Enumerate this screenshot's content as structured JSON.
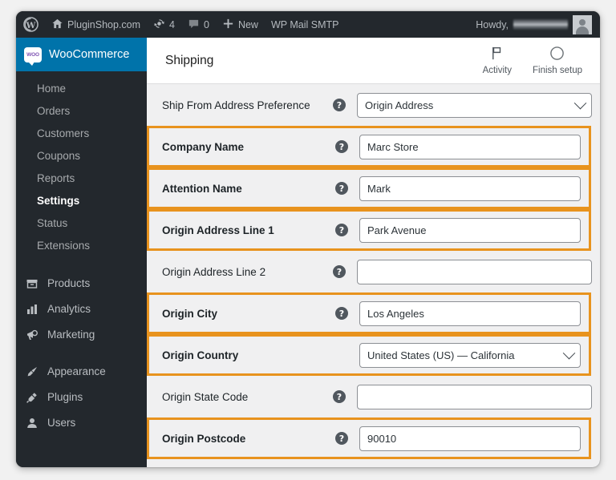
{
  "adminbar": {
    "logo_icon": "wordpress-logo-icon",
    "site": {
      "icon": "home-icon",
      "label": "PluginShop.com"
    },
    "updates": {
      "icon": "updates-icon",
      "count": "4"
    },
    "comments": {
      "icon": "comment-bubble-icon",
      "count": "0"
    },
    "new": {
      "icon": "plus-icon",
      "label": "New"
    },
    "plugin": {
      "label": "WP Mail SMTP"
    },
    "howdy": "Howdy,",
    "username_redacted": "",
    "avatar_icon": "avatar-icon"
  },
  "sidebar": {
    "current": {
      "label": "WooCommerce",
      "badge": "WOO",
      "icon": "woocommerce-icon"
    },
    "submenu": [
      {
        "label": "Home",
        "active": false
      },
      {
        "label": "Orders",
        "active": false
      },
      {
        "label": "Customers",
        "active": false
      },
      {
        "label": "Coupons",
        "active": false
      },
      {
        "label": "Reports",
        "active": false
      },
      {
        "label": "Settings",
        "active": true
      },
      {
        "label": "Status",
        "active": false
      },
      {
        "label": "Extensions",
        "active": false
      }
    ],
    "group_a": [
      {
        "label": "Products",
        "icon": "products-icon"
      },
      {
        "label": "Analytics",
        "icon": "analytics-bars-icon"
      },
      {
        "label": "Marketing",
        "icon": "megaphone-icon"
      }
    ],
    "group_b": [
      {
        "label": "Appearance",
        "icon": "paintbrush-icon"
      },
      {
        "label": "Plugins",
        "icon": "plug-icon"
      },
      {
        "label": "Users",
        "icon": "user-icon"
      }
    ]
  },
  "header": {
    "title": "Shipping",
    "actions": [
      {
        "label": "Activity",
        "icon": "flag-icon"
      },
      {
        "label": "Finish setup",
        "icon": "circle-progress-icon"
      }
    ]
  },
  "colors": {
    "highlight": "#e8931e",
    "admin_bar": "#23282d",
    "accent_blue": "#0073aa",
    "panel_bg": "#f0f0f1"
  },
  "form": {
    "rows": [
      {
        "label": "Ship From Address Preference",
        "help": true,
        "type": "select",
        "value": "Origin Address",
        "highlighted": false
      },
      {
        "label": "Company Name",
        "help": true,
        "type": "text",
        "value": "Marc Store",
        "highlighted": true
      },
      {
        "label": "Attention Name",
        "help": true,
        "type": "text",
        "value": "Mark",
        "highlighted": true
      },
      {
        "label": "Origin Address Line 1",
        "help": true,
        "type": "text",
        "value": "Park Avenue",
        "highlighted": true
      },
      {
        "label": "Origin Address Line 2",
        "help": true,
        "type": "text",
        "value": "",
        "highlighted": false
      },
      {
        "label": "Origin City",
        "help": true,
        "type": "text",
        "value": "Los Angeles",
        "highlighted": true
      },
      {
        "label": "Origin Country",
        "help": false,
        "type": "select",
        "value": "United States (US) — California",
        "highlighted": true
      },
      {
        "label": "Origin State Code",
        "help": true,
        "type": "text",
        "value": "",
        "highlighted": false
      },
      {
        "label": "Origin Postcode",
        "help": true,
        "type": "text",
        "value": "90010",
        "highlighted": true
      }
    ]
  }
}
